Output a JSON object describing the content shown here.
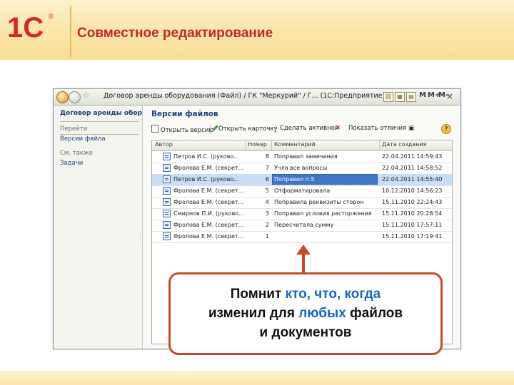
{
  "slide": {
    "title": "Совместное редактирование",
    "title_color": "#c0272d",
    "accent": "#c84a2a"
  },
  "logo": {
    "text": "1С",
    "reg_mark": "®"
  },
  "window": {
    "title": "Договор аренды оборудования (Файл) / ГК \"Меркурий\" / Г... (1С:Предприятие)",
    "toolbar_symbols": [
      "M",
      "M+",
      "M-"
    ],
    "close": "×",
    "sidebar": {
      "title": "Договор аренды обор...",
      "section_go": "Перейти",
      "items": [
        "Версии файла"
      ],
      "section_see_also": "См. также",
      "see_also_items": [
        "Задачи"
      ]
    },
    "content_title": "Версии файлов",
    "toolbar": {
      "open_version": "Открыть версию",
      "open_card": "Открыть карточку",
      "make_active": "Сделать активной",
      "show_diff": "Показать отличия",
      "help": "?"
    },
    "grid": {
      "columns": [
        "Автор",
        "Номер",
        "Комментарий",
        "Дата создания"
      ],
      "rows": [
        {
          "author": "Петров И.С. (руково...",
          "num": "8",
          "comment": "Поправил замечания",
          "date": "22.04.2011 14:59:43",
          "selected": false
        },
        {
          "author": "Фролова Е.М. (секрет...",
          "num": "7",
          "comment": "Учла все вопросы",
          "date": "22.04.2011 14:58:52",
          "selected": false
        },
        {
          "author": "Петров И.С. (руково...",
          "num": "6",
          "comment": "Поправил п.5",
          "date": "22.04.2011 14:55:40",
          "selected": true
        },
        {
          "author": "Фролова Е.М. (секрет...",
          "num": "5",
          "comment": "Отформатировала",
          "date": "10.12.2010 14:56:23",
          "selected": false
        },
        {
          "author": "Фролова Е.М. (секрет...",
          "num": "4",
          "comment": "Поправила реквизиты сторон",
          "date": "15.11.2010 22:24:43",
          "selected": false
        },
        {
          "author": "Смирнов П.И. (руково...",
          "num": "3",
          "comment": "Поправил условия расторжения",
          "date": "15.11.2010 20:28:54",
          "selected": false
        },
        {
          "author": "Фролова Е.М. (секрет...",
          "num": "2",
          "comment": "Пересчитала сумму",
          "date": "15.11.2010 17:57:11",
          "selected": false
        },
        {
          "author": "Фролова Е.М. (секрет...",
          "num": "1",
          "comment": "",
          "date": "15.11.2010 17:19:41",
          "selected": false
        }
      ]
    }
  },
  "callout": {
    "line1_plain": "Помнит ",
    "line1_highlight": "кто, что, когда",
    "line2_plain_a": "изменил для ",
    "line2_highlight": "любых",
    "line2_plain_b": " файлов",
    "line3": "и документов",
    "highlight_color": "#1a66c0"
  }
}
